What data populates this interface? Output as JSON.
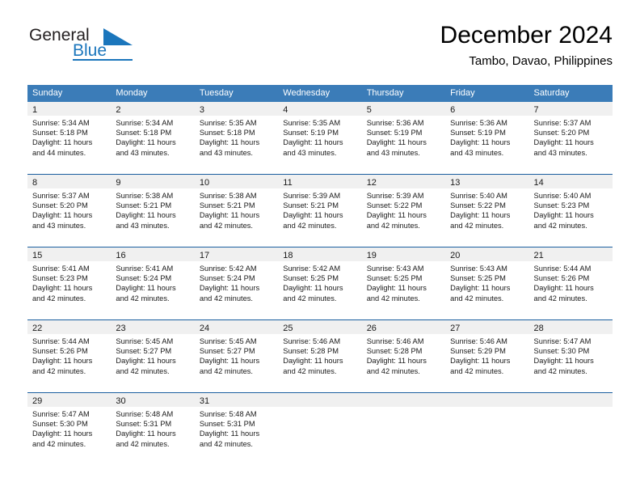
{
  "brand": {
    "name_part1": "General",
    "name_part2": "Blue",
    "accent_color": "#1b76bc"
  },
  "header": {
    "title": "December 2024",
    "subtitle": "Tambo, Davao, Philippines"
  },
  "calendar": {
    "header_bg": "#3b7cb8",
    "row_divider_color": "#1b5fa0",
    "daynum_bg": "#f0f0f0",
    "weekdays": [
      "Sunday",
      "Monday",
      "Tuesday",
      "Wednesday",
      "Thursday",
      "Friday",
      "Saturday"
    ],
    "weeks": [
      [
        {
          "day": "1",
          "lines": [
            "Sunrise: 5:34 AM",
            "Sunset: 5:18 PM",
            "Daylight: 11 hours",
            "and 44 minutes."
          ]
        },
        {
          "day": "2",
          "lines": [
            "Sunrise: 5:34 AM",
            "Sunset: 5:18 PM",
            "Daylight: 11 hours",
            "and 43 minutes."
          ]
        },
        {
          "day": "3",
          "lines": [
            "Sunrise: 5:35 AM",
            "Sunset: 5:18 PM",
            "Daylight: 11 hours",
            "and 43 minutes."
          ]
        },
        {
          "day": "4",
          "lines": [
            "Sunrise: 5:35 AM",
            "Sunset: 5:19 PM",
            "Daylight: 11 hours",
            "and 43 minutes."
          ]
        },
        {
          "day": "5",
          "lines": [
            "Sunrise: 5:36 AM",
            "Sunset: 5:19 PM",
            "Daylight: 11 hours",
            "and 43 minutes."
          ]
        },
        {
          "day": "6",
          "lines": [
            "Sunrise: 5:36 AM",
            "Sunset: 5:19 PM",
            "Daylight: 11 hours",
            "and 43 minutes."
          ]
        },
        {
          "day": "7",
          "lines": [
            "Sunrise: 5:37 AM",
            "Sunset: 5:20 PM",
            "Daylight: 11 hours",
            "and 43 minutes."
          ]
        }
      ],
      [
        {
          "day": "8",
          "lines": [
            "Sunrise: 5:37 AM",
            "Sunset: 5:20 PM",
            "Daylight: 11 hours",
            "and 43 minutes."
          ]
        },
        {
          "day": "9",
          "lines": [
            "Sunrise: 5:38 AM",
            "Sunset: 5:21 PM",
            "Daylight: 11 hours",
            "and 43 minutes."
          ]
        },
        {
          "day": "10",
          "lines": [
            "Sunrise: 5:38 AM",
            "Sunset: 5:21 PM",
            "Daylight: 11 hours",
            "and 42 minutes."
          ]
        },
        {
          "day": "11",
          "lines": [
            "Sunrise: 5:39 AM",
            "Sunset: 5:21 PM",
            "Daylight: 11 hours",
            "and 42 minutes."
          ]
        },
        {
          "day": "12",
          "lines": [
            "Sunrise: 5:39 AM",
            "Sunset: 5:22 PM",
            "Daylight: 11 hours",
            "and 42 minutes."
          ]
        },
        {
          "day": "13",
          "lines": [
            "Sunrise: 5:40 AM",
            "Sunset: 5:22 PM",
            "Daylight: 11 hours",
            "and 42 minutes."
          ]
        },
        {
          "day": "14",
          "lines": [
            "Sunrise: 5:40 AM",
            "Sunset: 5:23 PM",
            "Daylight: 11 hours",
            "and 42 minutes."
          ]
        }
      ],
      [
        {
          "day": "15",
          "lines": [
            "Sunrise: 5:41 AM",
            "Sunset: 5:23 PM",
            "Daylight: 11 hours",
            "and 42 minutes."
          ]
        },
        {
          "day": "16",
          "lines": [
            "Sunrise: 5:41 AM",
            "Sunset: 5:24 PM",
            "Daylight: 11 hours",
            "and 42 minutes."
          ]
        },
        {
          "day": "17",
          "lines": [
            "Sunrise: 5:42 AM",
            "Sunset: 5:24 PM",
            "Daylight: 11 hours",
            "and 42 minutes."
          ]
        },
        {
          "day": "18",
          "lines": [
            "Sunrise: 5:42 AM",
            "Sunset: 5:25 PM",
            "Daylight: 11 hours",
            "and 42 minutes."
          ]
        },
        {
          "day": "19",
          "lines": [
            "Sunrise: 5:43 AM",
            "Sunset: 5:25 PM",
            "Daylight: 11 hours",
            "and 42 minutes."
          ]
        },
        {
          "day": "20",
          "lines": [
            "Sunrise: 5:43 AM",
            "Sunset: 5:25 PM",
            "Daylight: 11 hours",
            "and 42 minutes."
          ]
        },
        {
          "day": "21",
          "lines": [
            "Sunrise: 5:44 AM",
            "Sunset: 5:26 PM",
            "Daylight: 11 hours",
            "and 42 minutes."
          ]
        }
      ],
      [
        {
          "day": "22",
          "lines": [
            "Sunrise: 5:44 AM",
            "Sunset: 5:26 PM",
            "Daylight: 11 hours",
            "and 42 minutes."
          ]
        },
        {
          "day": "23",
          "lines": [
            "Sunrise: 5:45 AM",
            "Sunset: 5:27 PM",
            "Daylight: 11 hours",
            "and 42 minutes."
          ]
        },
        {
          "day": "24",
          "lines": [
            "Sunrise: 5:45 AM",
            "Sunset: 5:27 PM",
            "Daylight: 11 hours",
            "and 42 minutes."
          ]
        },
        {
          "day": "25",
          "lines": [
            "Sunrise: 5:46 AM",
            "Sunset: 5:28 PM",
            "Daylight: 11 hours",
            "and 42 minutes."
          ]
        },
        {
          "day": "26",
          "lines": [
            "Sunrise: 5:46 AM",
            "Sunset: 5:28 PM",
            "Daylight: 11 hours",
            "and 42 minutes."
          ]
        },
        {
          "day": "27",
          "lines": [
            "Sunrise: 5:46 AM",
            "Sunset: 5:29 PM",
            "Daylight: 11 hours",
            "and 42 minutes."
          ]
        },
        {
          "day": "28",
          "lines": [
            "Sunrise: 5:47 AM",
            "Sunset: 5:30 PM",
            "Daylight: 11 hours",
            "and 42 minutes."
          ]
        }
      ],
      [
        {
          "day": "29",
          "lines": [
            "Sunrise: 5:47 AM",
            "Sunset: 5:30 PM",
            "Daylight: 11 hours",
            "and 42 minutes."
          ]
        },
        {
          "day": "30",
          "lines": [
            "Sunrise: 5:48 AM",
            "Sunset: 5:31 PM",
            "Daylight: 11 hours",
            "and 42 minutes."
          ]
        },
        {
          "day": "31",
          "lines": [
            "Sunrise: 5:48 AM",
            "Sunset: 5:31 PM",
            "Daylight: 11 hours",
            "and 42 minutes."
          ]
        },
        {
          "day": "",
          "lines": []
        },
        {
          "day": "",
          "lines": []
        },
        {
          "day": "",
          "lines": []
        },
        {
          "day": "",
          "lines": []
        }
      ]
    ]
  }
}
